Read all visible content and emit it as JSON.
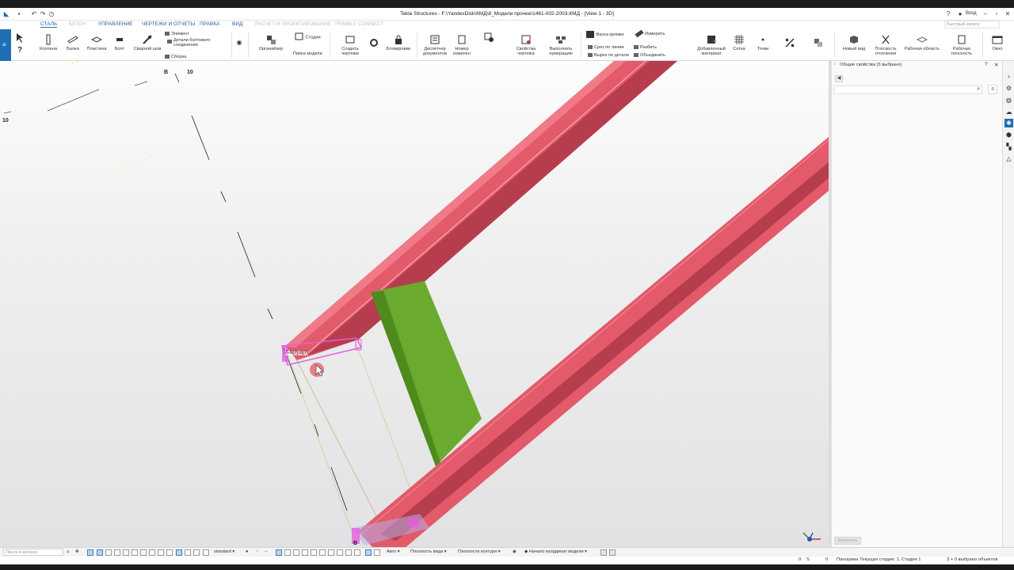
{
  "window": {
    "title": "Tekla Structures - F:\\YandexDisk\\КМД\\8_Модели прочее\\1461-002-2003-КМД - [View 1 - 3D]",
    "login": "Вход",
    "quick_launch": "Быстрый запуск"
  },
  "tabs": [
    {
      "label": "СТАЛЬ",
      "state": "active"
    },
    {
      "label": "БЕТОН",
      "state": "dim"
    },
    {
      "label": "УПРАВЛЕНИЕ",
      "state": "normal"
    },
    {
      "label": "ЧЕРТЕЖИ И ОТЧЕТЫ",
      "state": "normal"
    },
    {
      "label": "ПРАВКА",
      "state": "normal"
    },
    {
      "label": "ВИД",
      "state": "normal"
    },
    {
      "label": "РАСЧЕТ И ПРОЕКТИРОВАНИЕ",
      "state": "dim"
    },
    {
      "label": "TRIMBLE CONNECT",
      "state": "dim"
    }
  ],
  "ribbon": {
    "column": "Колонна",
    "beam": "Балка",
    "plate": "Пластина",
    "bolt": "Болт",
    "weld": "Сварной шов",
    "element": "Элемент",
    "bolt_details": "Детали болтового соединения",
    "assembly": "Сборка",
    "organizer": "Органайзер",
    "stages": "Стадии",
    "model_folder": "Папка модели",
    "create_drawings": "Создать чертежи",
    "lock": "Блокировки",
    "doc_manager": "Диспетчер документов",
    "change_number": "Номер изменен",
    "drawing_props": "Свойства чертежа",
    "numbering": "Выполнить нумерацию",
    "chamfer": "Фаска кромки",
    "measure": "Измерить",
    "line_cut": "Срез по линии",
    "split": "Разбить",
    "part_cut": "Вырез по детали",
    "combine": "Объединить",
    "add_material": "Добавленный материал",
    "grid": "Сетка",
    "points": "Точки",
    "new_view": "Новый вид",
    "clip_planes": "Плоскость отсечения",
    "work_area": "Рабочая область",
    "work_plane": "Рабочая плоскость",
    "window": "Окно"
  },
  "viewport": {
    "grid_labels": {
      "b_top": "B",
      "ten_top": "10",
      "ten_left": "10",
      "b_bottom": "B"
    },
    "dim_label": "Л-0(?) 0(?)"
  },
  "panel": {
    "title": "Общие свойства (3 выбрано)",
    "modify": "Изменить"
  },
  "statusbar": {
    "search_placeholder": "Поиск в модели",
    "select_filter": "standard",
    "auto": "Авто",
    "view_plane": "Плоскость вида",
    "contour_plane": "Плоскости контура",
    "origin": "Начало координат модели"
  },
  "infobar": {
    "n0": "0",
    "s": "S",
    "n1": "0",
    "phase": "Панорама  Текущая стадия: 1, Стадия 1",
    "selected": "3 + 0 выбрано объектов"
  },
  "colors": {
    "steel": "#e35a6a",
    "steel_dark": "#b93f50",
    "plate": "#6aaa2e",
    "highlight": "#e65ce0",
    "accent": "#1f6fb5"
  }
}
